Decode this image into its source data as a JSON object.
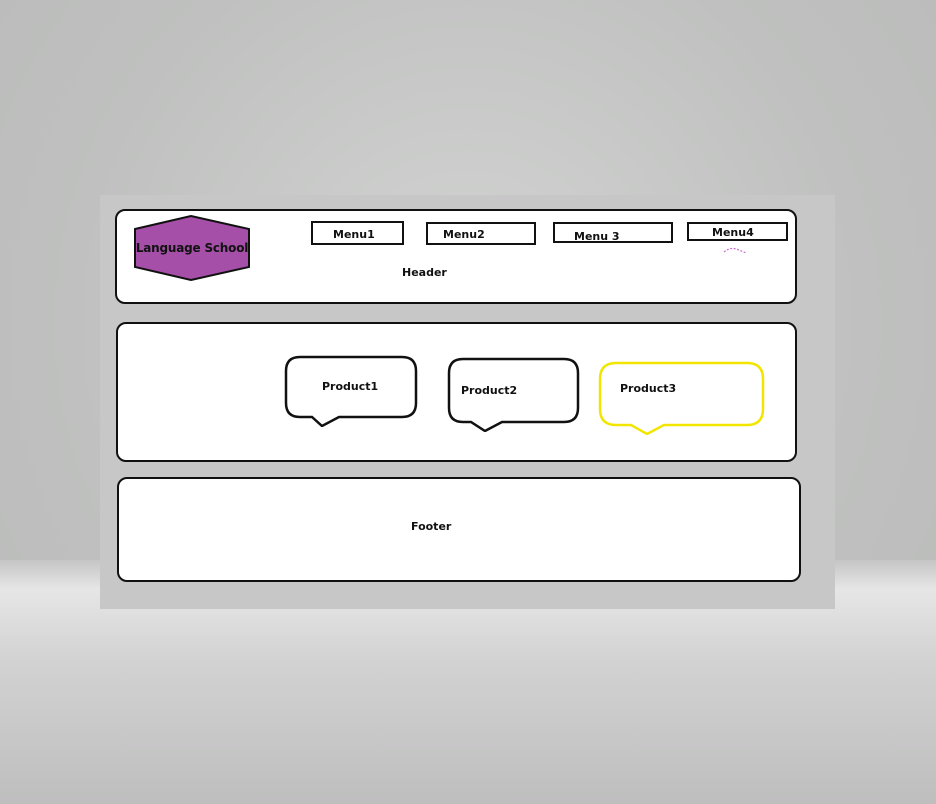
{
  "logo": {
    "text": "Language School",
    "fill_color": "#a64fa9"
  },
  "header": {
    "label": "Header",
    "menus": [
      {
        "label": "Menu1"
      },
      {
        "label": "Menu2"
      },
      {
        "label": "Menu 3"
      },
      {
        "label": "Menu4"
      }
    ]
  },
  "products": [
    {
      "label": "Product1",
      "border_color": "#111111"
    },
    {
      "label": "Product2",
      "border_color": "#111111"
    },
    {
      "label": "Product3",
      "border_color": "#f2e600"
    }
  ],
  "footer": {
    "label": "Footer"
  }
}
